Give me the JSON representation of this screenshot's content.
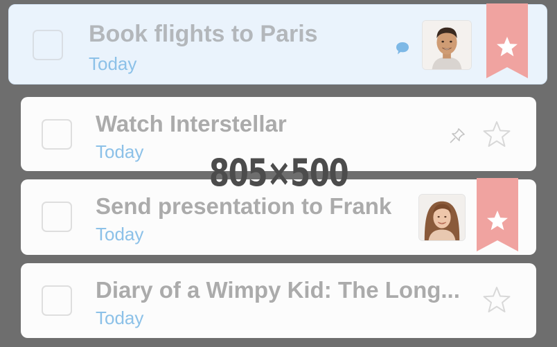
{
  "tasks": [
    {
      "title": "Book flights to Paris",
      "due": "Today",
      "starred": true,
      "selected": true,
      "has_comment": true,
      "assignee_avatar": "male-avatar"
    },
    {
      "title": "Watch Interstellar",
      "due": "Today",
      "starred": false,
      "pinned": true
    },
    {
      "title": "Send presentation to Frank",
      "due": "Today",
      "starred": true,
      "assignee_avatar": "female-avatar"
    },
    {
      "title": "Diary of a Wimpy Kid: The Long...",
      "due": "Today",
      "starred": false
    }
  ],
  "watermark": "805×500",
  "colors": {
    "background": "#6e6e6e",
    "card": "#fcfcfc",
    "selected_card": "#eaf3fc",
    "title_text": "#ababab",
    "due_text": "#8cc1e8",
    "bookmark": "#f0a3a0",
    "comment_icon": "#7db8e6",
    "star_outline": "#dcdcdc"
  },
  "icons": {
    "comment": "speech-bubble",
    "pin": "pushpin",
    "starred": "bookmark-star",
    "unstarred": "star-outline"
  }
}
